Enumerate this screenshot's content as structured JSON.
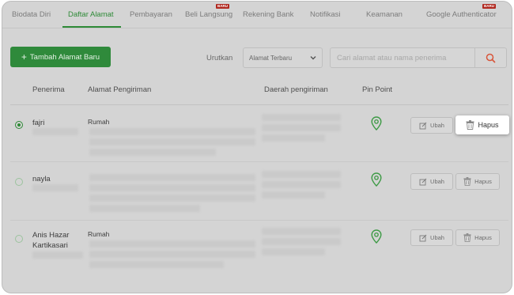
{
  "tabs": [
    {
      "label": "Biodata Diri"
    },
    {
      "label": "Daftar Alamat"
    },
    {
      "label": "Pembayaran"
    },
    {
      "label": "Beli Langsung",
      "badge": "BARU"
    },
    {
      "label": "Rekening Bank"
    },
    {
      "label": "Notifikasi"
    },
    {
      "label": "Keamanan"
    },
    {
      "label": "Google Authenticator",
      "badge": "BARU"
    }
  ],
  "active_tab": "Daftar Alamat",
  "toolbar": {
    "add_label": "Tambah Alamat Baru",
    "add_icon": "plus",
    "sort_label": "Urutkan",
    "sort_value": "Alamat Terbaru",
    "search_placeholder": "Cari alamat atau nama penerima",
    "search_icon": "search"
  },
  "table": {
    "headers": [
      "Penerima",
      "Alamat Pengiriman",
      "Daerah pengiriman",
      "Pin Point"
    ],
    "rows": [
      {
        "name": "fajri",
        "address_label": "Rumah",
        "selected": true,
        "edit_label": "Ubah",
        "delete_label": "Hapus",
        "delete_highlighted": true
      },
      {
        "name": "nayla",
        "address_label": "",
        "selected": false,
        "edit_label": "Ubah",
        "delete_label": "Hapus",
        "delete_highlighted": false
      },
      {
        "name": "Anis Hazar Kartikasari",
        "address_label": "Rumah",
        "selected": false,
        "edit_label": "Ubah",
        "delete_label": "Hapus",
        "delete_highlighted": false
      }
    ]
  },
  "colors": {
    "accent": "#2e8a37",
    "badge": "#b0281f",
    "search_icon": "#d8553a"
  }
}
